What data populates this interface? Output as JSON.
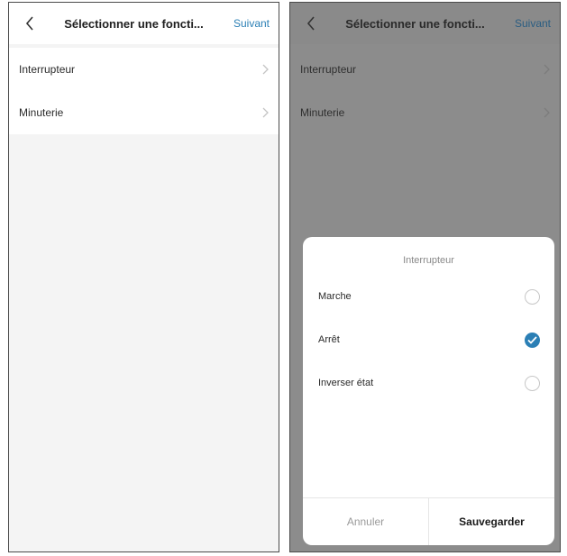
{
  "left_screen": {
    "header": {
      "back_icon": "chevron-left-icon",
      "title": "Sélectionner une foncti...",
      "next_label": "Suivant"
    },
    "list": [
      {
        "label": "Interrupteur",
        "icon": "chevron-right-icon"
      },
      {
        "label": "Minuterie",
        "icon": "chevron-right-icon"
      }
    ]
  },
  "right_screen": {
    "header": {
      "back_icon": "chevron-left-icon",
      "title": "Sélectionner une foncti...",
      "next_label": "Suivant"
    },
    "list": [
      {
        "label": "Interrupteur"
      },
      {
        "label": "Minuterie"
      }
    ],
    "sheet": {
      "title": "Interrupteur",
      "options": [
        {
          "label": "Marche",
          "selected": false
        },
        {
          "label": "Arrêt",
          "selected": true
        },
        {
          "label": "Inverser état",
          "selected": false
        }
      ],
      "cancel_label": "Annuler",
      "save_label": "Sauvegarder"
    }
  },
  "colors": {
    "accent": "#2b7fb5",
    "overlay": "#8c8c8c"
  }
}
